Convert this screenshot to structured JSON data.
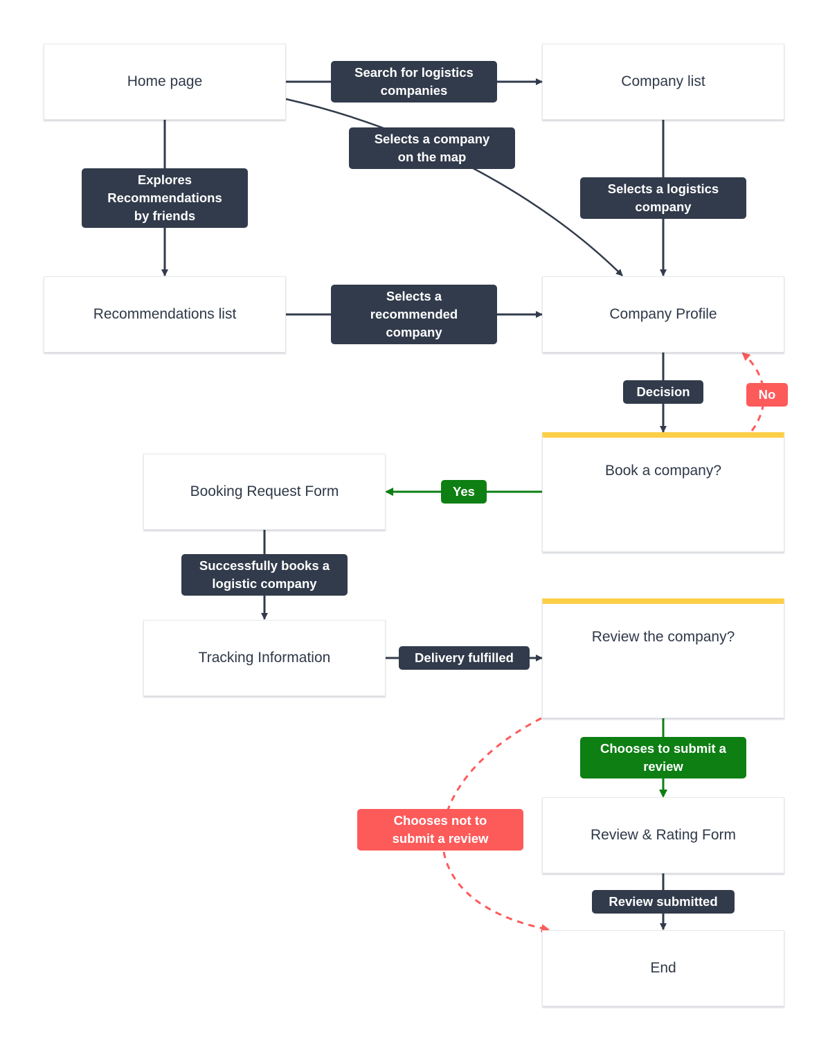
{
  "colors": {
    "edge_default": "#323b4b",
    "edge_yes": "#0d7f13",
    "edge_no": "#fd5a5a",
    "decision_accent": "#fdcf49",
    "node_text": "#2f3848"
  },
  "nodes": {
    "home_page": "Home page",
    "company_list": "Company list",
    "recommendations_list": "Recommendations list",
    "company_profile": "Company Profile",
    "book_company": "Book a company?",
    "booking_request_form": "Booking Request Form",
    "tracking_information": "Tracking Information",
    "review_company": "Review the company?",
    "review_rating_form": "Review & Rating Form",
    "end": "End"
  },
  "edges": {
    "search_logistics": "Search for logistics\ncompanies",
    "selects_on_map": "Selects a company\non the map",
    "explores_recommendations": "Explores\nRecommendations\nby friends",
    "selects_logistics_company": "Selects a logistics\ncompany",
    "selects_recommended": "Selects a\nrecommended\ncompany",
    "decision": "Decision",
    "no": "No",
    "yes": "Yes",
    "successfully_books": "Successfully books a\nlogistic company",
    "delivery_fulfilled": "Delivery fulfilled",
    "chooses_submit": "Chooses to submit a\nreview",
    "chooses_not_submit": "Chooses not to\nsubmit a review",
    "review_submitted": "Review submitted"
  }
}
